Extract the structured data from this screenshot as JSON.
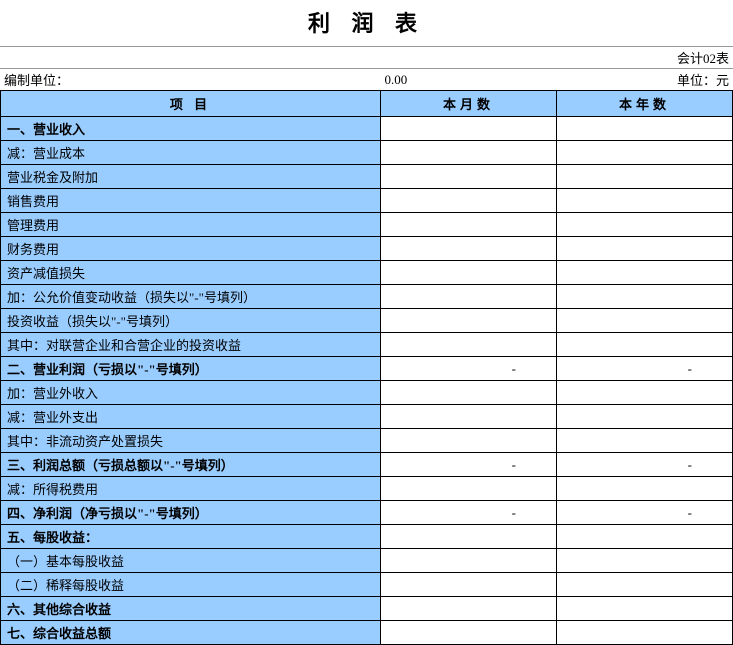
{
  "title": "利 润 表",
  "meta": {
    "form_code": "会计02表",
    "prepared_by_label": "编制单位：",
    "period_value": "0.00",
    "unit_label": "单位：元"
  },
  "header": {
    "col_item": "项 目",
    "col_month": "本月数",
    "col_year": "本年数"
  },
  "rows": [
    {
      "label": "一、营业收入",
      "bold": true,
      "month": "",
      "year": ""
    },
    {
      "label": "减：营业成本",
      "bold": false,
      "month": "",
      "year": ""
    },
    {
      "label": "营业税金及附加",
      "bold": false,
      "month": "",
      "year": ""
    },
    {
      "label": "销售费用",
      "bold": false,
      "month": "",
      "year": ""
    },
    {
      "label": "管理费用",
      "bold": false,
      "month": "",
      "year": ""
    },
    {
      "label": "财务费用",
      "bold": false,
      "month": "",
      "year": ""
    },
    {
      "label": "资产减值损失",
      "bold": false,
      "month": "",
      "year": ""
    },
    {
      "label": "加：公允价值变动收益（损失以\"-\"号填列）",
      "bold": false,
      "month": "",
      "year": ""
    },
    {
      "label": "投资收益（损失以\"-\"号填列）",
      "bold": false,
      "month": "",
      "year": ""
    },
    {
      "label": "其中：对联营企业和合营企业的投资收益",
      "bold": false,
      "month": "",
      "year": ""
    },
    {
      "label": "二、营业利润（亏损以\"-\"号填列）",
      "bold": true,
      "month": "-",
      "year": "-"
    },
    {
      "label": "加：营业外收入",
      "bold": false,
      "month": "",
      "year": ""
    },
    {
      "label": "减：营业外支出",
      "bold": false,
      "month": "",
      "year": ""
    },
    {
      "label": "其中：非流动资产处置损失",
      "bold": false,
      "month": "",
      "year": ""
    },
    {
      "label": "三、利润总额（亏损总额以\"-\"号填列）",
      "bold": true,
      "month": "-",
      "year": "-"
    },
    {
      "label": "减：所得税费用",
      "bold": false,
      "month": "",
      "year": ""
    },
    {
      "label": "四、净利润（净亏损以\"-\"号填列）",
      "bold": true,
      "month": "-",
      "year": "-"
    },
    {
      "label": "五、每股收益：",
      "bold": true,
      "month": "",
      "year": ""
    },
    {
      "label": "（一）基本每股收益",
      "bold": false,
      "month": "",
      "year": ""
    },
    {
      "label": "（二）稀释每股收益",
      "bold": false,
      "month": "",
      "year": ""
    },
    {
      "label": "六、其他综合收益",
      "bold": true,
      "month": "",
      "year": ""
    },
    {
      "label": "七、综合收益总额",
      "bold": true,
      "month": "",
      "year": ""
    }
  ]
}
